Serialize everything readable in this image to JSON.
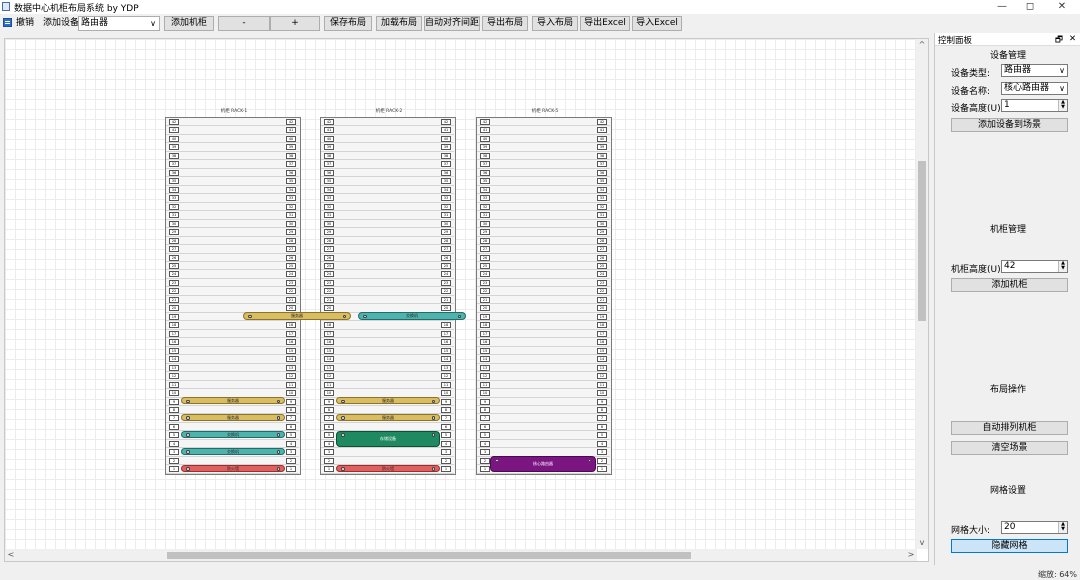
{
  "window": {
    "title": "数据中心机柜布局系统 by YDP",
    "min": "—",
    "max": "◻",
    "close": "✕"
  },
  "toolbar": {
    "undo": "撤销",
    "add_device_label": "添加设备:",
    "device_value": "路由器",
    "add_rack": "添加机柜",
    "minus": "-",
    "plus": "+",
    "save": "保存布局",
    "load": "加载布局",
    "auto_align": "自动对齐间距",
    "export_layout": "导出布局",
    "import_layout": "导入布局",
    "export_excel": "导出Excel",
    "import_excel": "导入Excel"
  },
  "racks": [
    {
      "title": "机柜 RACK-1",
      "units": 42
    },
    {
      "title": "机柜 RACK-2",
      "units": 42
    },
    {
      "title": "机柜 RACK-5",
      "units": 42
    }
  ],
  "devices": [
    {
      "label": "服务器",
      "type": "server",
      "rack": 0,
      "u": 19,
      "height": 1,
      "over": true
    },
    {
      "label": "交换机",
      "type": "switch",
      "rack": 1,
      "u": 19,
      "height": 1,
      "over": true
    },
    {
      "label": "服务器",
      "type": "server",
      "rack": 0,
      "u": 9,
      "height": 1
    },
    {
      "label": "服务器",
      "type": "server",
      "rack": 0,
      "u": 7,
      "height": 1
    },
    {
      "label": "交换机",
      "type": "switch",
      "rack": 0,
      "u": 5,
      "height": 1
    },
    {
      "label": "交换机",
      "type": "switch",
      "rack": 0,
      "u": 3,
      "height": 1
    },
    {
      "label": "防火墙",
      "type": "firewall",
      "rack": 0,
      "u": 1,
      "height": 1
    },
    {
      "label": "服务器",
      "type": "server",
      "rack": 1,
      "u": 9,
      "height": 1
    },
    {
      "label": "服务器",
      "type": "server",
      "rack": 1,
      "u": 7,
      "height": 1
    },
    {
      "label": "存储设备",
      "type": "storage",
      "rack": 1,
      "u": 4,
      "height": 2
    },
    {
      "label": "防火墙",
      "type": "firewall",
      "rack": 1,
      "u": 1,
      "height": 1
    },
    {
      "label": "核心路由器",
      "type": "router",
      "rack": 2,
      "u": 1,
      "height": 2
    }
  ],
  "panel": {
    "title": "控制面板",
    "float": "🗗",
    "close": "✕",
    "device_section": "设备管理",
    "type_label": "设备类型:",
    "type_value": "路由器",
    "name_label": "设备名称:",
    "name_value": "核心路由器",
    "height_label": "设备高度(U):",
    "height_value": "1",
    "add_to_scene": "添加设备到场景",
    "rack_section": "机柜管理",
    "rack_height_label": "机柜高度(U):",
    "rack_height_value": "42",
    "add_rack": "添加机柜",
    "layout_section": "布局操作",
    "auto_arrange": "自动排列机柜",
    "clear_scene": "清空场景",
    "grid_section": "网格设置",
    "grid_size_label": "网格大小:",
    "grid_size_value": "20",
    "hide_grid": "隐藏网格"
  },
  "zoom": "缩放: 64%",
  "colors": {
    "server": "#d9bd63",
    "switch": "#4fb3ad",
    "firewall": "#e06060",
    "storage": "#1f8a62",
    "router": "#7b1582",
    "accent": "#0078d7"
  }
}
